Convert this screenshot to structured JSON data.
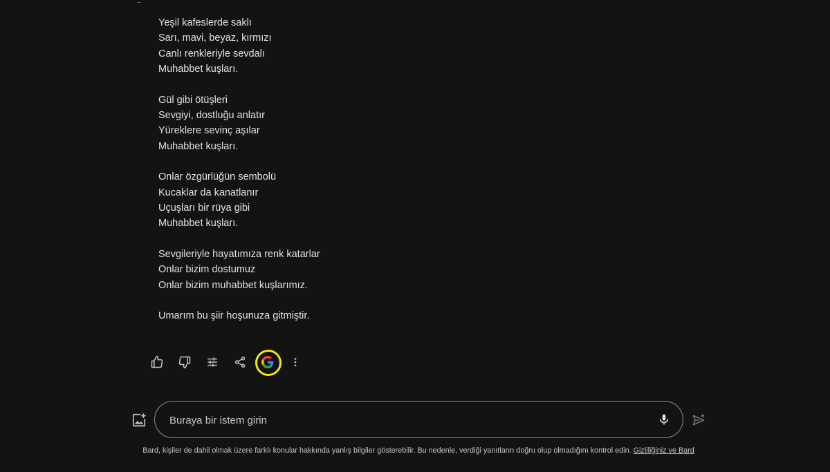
{
  "response": {
    "stanzas": [
      [
        "Yeşil kafeslerde saklı",
        "Sarı, mavi, beyaz, kırmızı",
        "Canlı renkleriyle sevdalı",
        "Muhabbet kuşları."
      ],
      [
        "Gül gibi ötüşleri",
        "Sevgiyi, dostluğu anlatır",
        "Yüreklere sevinç aşılar",
        "Muhabbet kuşları."
      ],
      [
        "Onlar özgürlüğün sembolü",
        "Kucaklar da kanatlanır",
        "Uçuşları bir rüya gibi",
        "Muhabbet kuşları."
      ],
      [
        "Sevgileriyle hayatımıza renk katarlar",
        "Onlar bizim dostumuz",
        "Onlar bizim muhabbet kuşlarımız."
      ]
    ],
    "closing": "Umarım bu şiir hoşunuza gitmiştir."
  },
  "actions": {
    "icons": [
      "thumb-up-icon",
      "thumb-down-icon",
      "tune-icon",
      "share-icon",
      "google-g-icon",
      "more-vert-icon"
    ],
    "highlight_color": "#f5e80f"
  },
  "composer": {
    "placeholder": "Buraya bir istem girin",
    "upload_icon": "add-photo-icon",
    "mic_icon": "mic-icon",
    "send_icon": "send-icon"
  },
  "footer": {
    "text": "Bard, kişiler de dahil olmak üzere farklı konular hakkında yanlış bilgiler gösterebilir. Bu nedenle, verdiği yanıtların doğru olup olmadığını kontrol edin.",
    "link": "Gizliliğiniz ve Bard"
  },
  "colors": {
    "background": "#131314",
    "text": "#e3e3e3",
    "muted": "#c4c7c5"
  }
}
